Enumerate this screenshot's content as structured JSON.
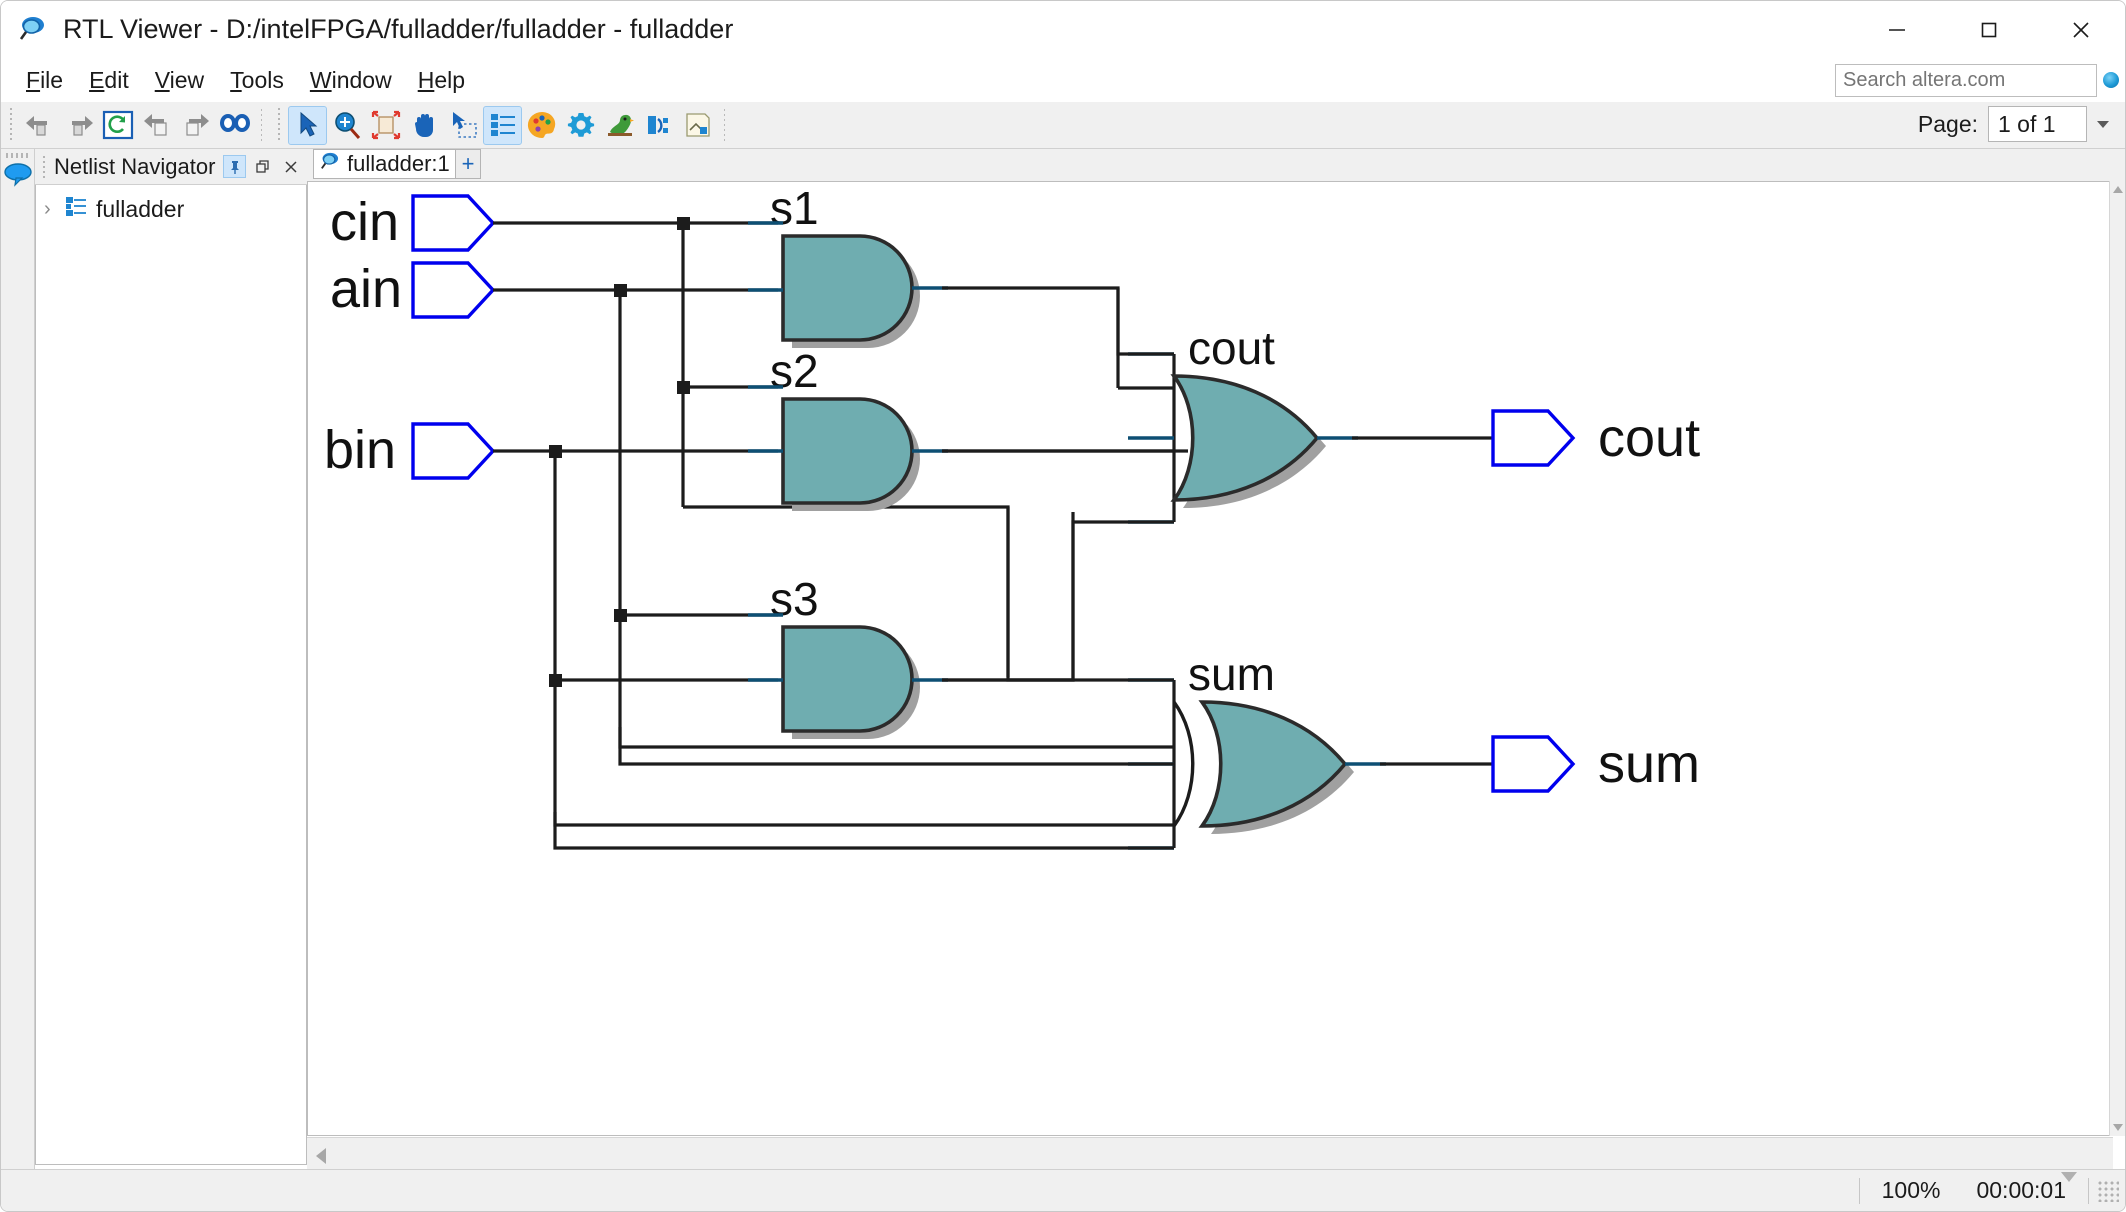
{
  "window": {
    "title": "RTL Viewer - D:/intelFPGA/fulladder/fulladder - fulladder",
    "icon": "rtl-viewer-magnifier-icon",
    "minimize_label": "—",
    "maximize_label": "☐",
    "close_label": "✕"
  },
  "menu": {
    "items": [
      {
        "label": "File",
        "mnemonic": "F"
      },
      {
        "label": "Edit",
        "mnemonic": "E"
      },
      {
        "label": "View",
        "mnemonic": "V"
      },
      {
        "label": "Tools",
        "mnemonic": "T"
      },
      {
        "label": "Window",
        "mnemonic": "W"
      },
      {
        "label": "Help",
        "mnemonic": "H"
      }
    ]
  },
  "search": {
    "placeholder": "Search altera.com",
    "value": "",
    "icon": "globe-icon"
  },
  "toolbar": {
    "buttons": [
      {
        "name": "back-icon",
        "tip": "Back"
      },
      {
        "name": "forward-icon",
        "tip": "Forward"
      },
      {
        "name": "refresh-icon",
        "tip": "Refresh"
      },
      {
        "name": "previous-page-icon",
        "tip": "Previous Page"
      },
      {
        "name": "next-page-icon",
        "tip": "Next Page"
      },
      {
        "name": "find-icon",
        "tip": "Find"
      },
      {
        "name": "select-tool-icon",
        "tip": "Selection Tool",
        "active": true
      },
      {
        "name": "zoom-tool-icon",
        "tip": "Zoom Tool"
      },
      {
        "name": "fit-in-window-icon",
        "tip": "Fit in Window"
      },
      {
        "name": "hand-tool-icon",
        "tip": "Hand Tool"
      },
      {
        "name": "area-select-icon",
        "tip": "Area Select"
      },
      {
        "name": "hierarchy-icon",
        "tip": "Netlist Navigator",
        "active": true
      },
      {
        "name": "color-palette-icon",
        "tip": "Colors"
      },
      {
        "name": "settings-gear-icon",
        "tip": "Settings"
      },
      {
        "name": "bird-icon",
        "tip": "Bird's Eye View"
      },
      {
        "name": "partition-icon",
        "tip": "Partition"
      },
      {
        "name": "export-image-icon",
        "tip": "Export"
      }
    ],
    "page_label": "Page:",
    "page_value": "1 of 1"
  },
  "dock": {
    "messages_icon": "speech-bubble-icon"
  },
  "navigator": {
    "title": "Netlist Navigator",
    "pin_icon": "pin-icon",
    "float_icon": "restore-icon",
    "close_icon": "close-icon",
    "tree": [
      {
        "label": "fulladder",
        "expander": "›",
        "icon": "hierarchy-node-icon"
      }
    ]
  },
  "tabs": {
    "items": [
      {
        "label": "fulladder:1",
        "icon": "rtl-viewer-magnifier-icon",
        "active": true
      }
    ],
    "add_label": "+"
  },
  "statusbar": {
    "zoom": "100%",
    "time": "00:00:01"
  },
  "colors": {
    "gate_fill": "#6fadb0",
    "gate_stroke": "#2b2b2b",
    "gate_shadow": "#a0a0a0",
    "pin_stroke": "#0000ee",
    "wire": "#1c1c1c",
    "port_stub": "#0d4f73",
    "accent_blue": "#1a64b8"
  },
  "schematic": {
    "title": "fulladder RTL netlist",
    "inputs": [
      {
        "name": "cin",
        "label": "cin"
      },
      {
        "name": "ain",
        "label": "ain"
      },
      {
        "name": "bin",
        "label": "bin"
      }
    ],
    "gates": [
      {
        "name": "s1",
        "label": "s1",
        "type": "AND",
        "inputs": 2
      },
      {
        "name": "s2",
        "label": "s2",
        "type": "AND",
        "inputs": 2
      },
      {
        "name": "s3",
        "label": "s3",
        "type": "AND",
        "inputs": 2
      },
      {
        "name": "cout",
        "label": "cout",
        "type": "OR",
        "inputs": 3
      },
      {
        "name": "sum",
        "label": "sum",
        "type": "XOR",
        "inputs": 3
      }
    ],
    "outputs": [
      {
        "name": "cout",
        "label": "cout"
      },
      {
        "name": "sum",
        "label": "sum"
      }
    ]
  }
}
